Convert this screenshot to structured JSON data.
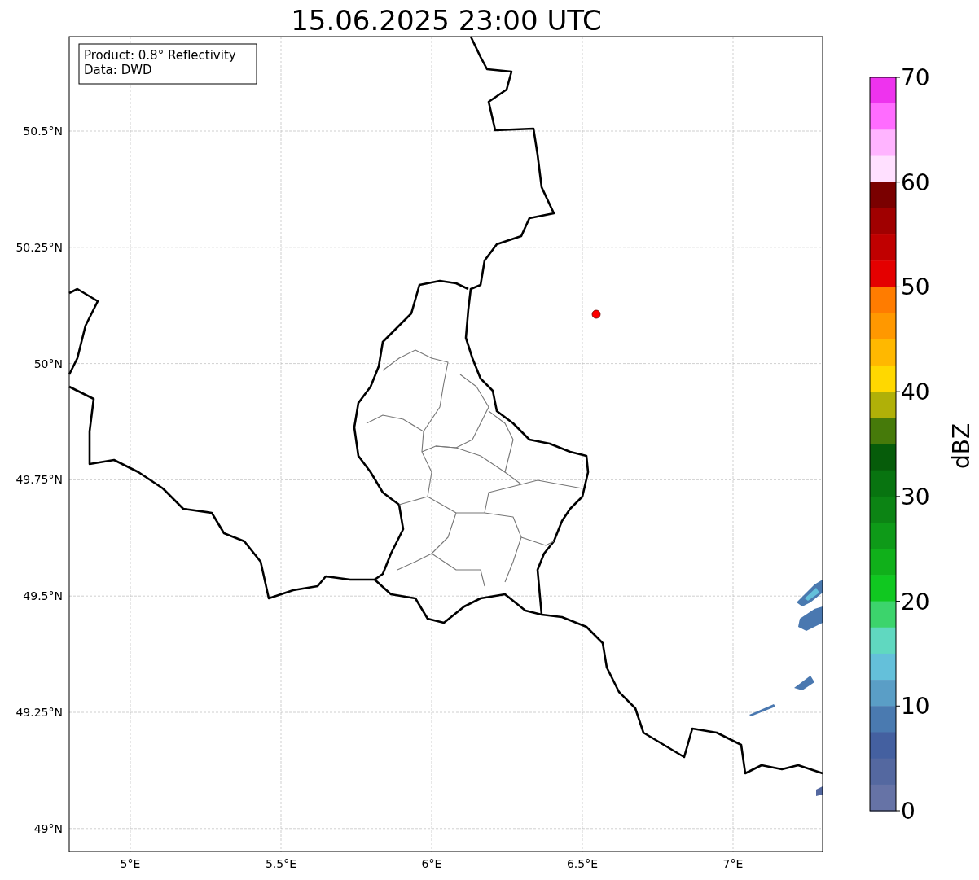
{
  "title": "15.06.2025 23:00 UTC",
  "map": {
    "info_box": [
      "Product: 0.8° Reflectivity",
      "Data: DWD"
    ],
    "xticks": [
      "5°E",
      "5.5°E",
      "6°E",
      "6.5°E",
      "7°E"
    ],
    "yticks": [
      "50.5°N",
      "50.25°N",
      "50°N",
      "49.75°N",
      "49.5°N",
      "49.25°N",
      "49°N"
    ]
  },
  "colorbar": {
    "label": "dBZ",
    "ticks": [
      "70",
      "60",
      "50",
      "40",
      "30",
      "20",
      "10",
      "0"
    ],
    "segments": [
      {
        "color": "#ee33ee"
      },
      {
        "color": "#ff6cff"
      },
      {
        "color": "#ffb4ff"
      },
      {
        "color": "#ffe0ff"
      },
      {
        "color": "#7a0000"
      },
      {
        "color": "#a00000"
      },
      {
        "color": "#c00000"
      },
      {
        "color": "#e40000"
      },
      {
        "color": "#ff7c00"
      },
      {
        "color": "#ff9800"
      },
      {
        "color": "#ffb800"
      },
      {
        "color": "#ffd800"
      },
      {
        "color": "#b0b008"
      },
      {
        "color": "#467a0a"
      },
      {
        "color": "#065c0a"
      },
      {
        "color": "#087410"
      },
      {
        "color": "#0c8414"
      },
      {
        "color": "#0e9a18"
      },
      {
        "color": "#10b01a"
      },
      {
        "color": "#10c820"
      },
      {
        "color": "#3cd46c"
      },
      {
        "color": "#60d8c0"
      },
      {
        "color": "#64c0da"
      },
      {
        "color": "#5a9ec6"
      },
      {
        "color": "#4a7ab0"
      },
      {
        "color": "#4460a0"
      },
      {
        "color": "#5468a0"
      },
      {
        "color": "#6673a6"
      }
    ]
  }
}
